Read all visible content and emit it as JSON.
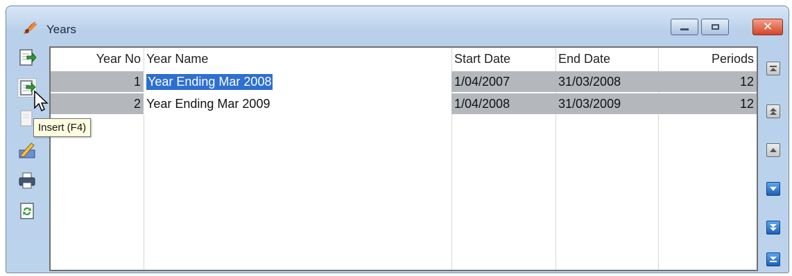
{
  "window": {
    "title": "Years",
    "tooltip": "Insert (F4)"
  },
  "grid": {
    "columns": [
      "Year No",
      "Year Name",
      "Start Date",
      "End Date",
      "Periods"
    ],
    "rows": [
      {
        "year_no": "1",
        "year_name": "Year Ending Mar 2008",
        "start_date": "1/04/2007",
        "end_date": "31/03/2008",
        "periods": "12"
      },
      {
        "year_no": "2",
        "year_name": "Year Ending Mar 2009",
        "start_date": "1/04/2008",
        "end_date": "31/03/2009",
        "periods": "12"
      }
    ]
  },
  "toolbar_left": [
    "add-record-icon",
    "insert-record-icon",
    "delete-record-icon",
    "edit-record-icon",
    "print-icon",
    "refresh-icon"
  ],
  "toolbar_right": [
    "first-record-icon",
    "page-up-icon",
    "prior-record-icon",
    "next-record-icon",
    "page-down-icon",
    "last-record-icon"
  ],
  "colors": {
    "selection": "#2d6fd2",
    "row_gray": "#b4b8bd",
    "close_button": "#d6432a",
    "nav_active": "#1f5fb7"
  }
}
